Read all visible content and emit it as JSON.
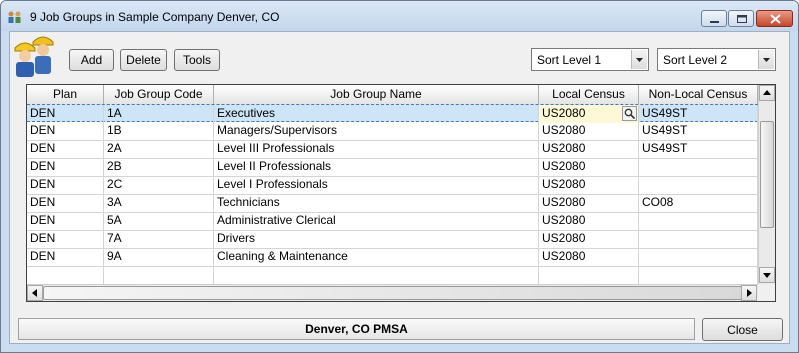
{
  "window": {
    "title": "9 Job Groups in Sample Company Denver, CO",
    "icons": {
      "app": "people-group-icon",
      "minimize": "minimize-icon",
      "maximize": "maximize-icon",
      "close": "close-icon",
      "mascot": "workers-mascot-icon"
    }
  },
  "toolbar": {
    "add_label": "Add",
    "delete_label": "Delete",
    "tools_label": "Tools",
    "sort_level_1": "Sort Level 1",
    "sort_level_2": "Sort Level 2"
  },
  "table": {
    "columns": [
      "Plan",
      "Job Group Code",
      "Job Group Name",
      "Local Census",
      "Non-Local Census"
    ],
    "rows": [
      [
        "DEN",
        "1A",
        "Executives",
        "US2080",
        "US49ST"
      ],
      [
        "DEN",
        "1B",
        "Managers/Supervisors",
        "US2080",
        "US49ST"
      ],
      [
        "DEN",
        "2A",
        "Level III Professionals",
        "US2080",
        "US49ST"
      ],
      [
        "DEN",
        "2B",
        "Level II Professionals",
        "US2080",
        ""
      ],
      [
        "DEN",
        "2C",
        "Level I Professionals",
        "US2080",
        ""
      ],
      [
        "DEN",
        "3A",
        "Technicians",
        "US2080",
        "CO08"
      ],
      [
        "DEN",
        "5A",
        "Administrative Clerical",
        "US2080",
        ""
      ],
      [
        "DEN",
        "7A",
        "Drivers",
        "US2080",
        ""
      ],
      [
        "DEN",
        "9A",
        "Cleaning & Maintenance",
        "US2080",
        ""
      ]
    ],
    "selected_row": 0
  },
  "footer": {
    "status_text": "Denver, CO PMSA",
    "close_label": "Close"
  },
  "colors": {
    "selection": "#cde5f7",
    "edit_cell": "#fff8d6",
    "title_bar": "#c9dcf0"
  }
}
